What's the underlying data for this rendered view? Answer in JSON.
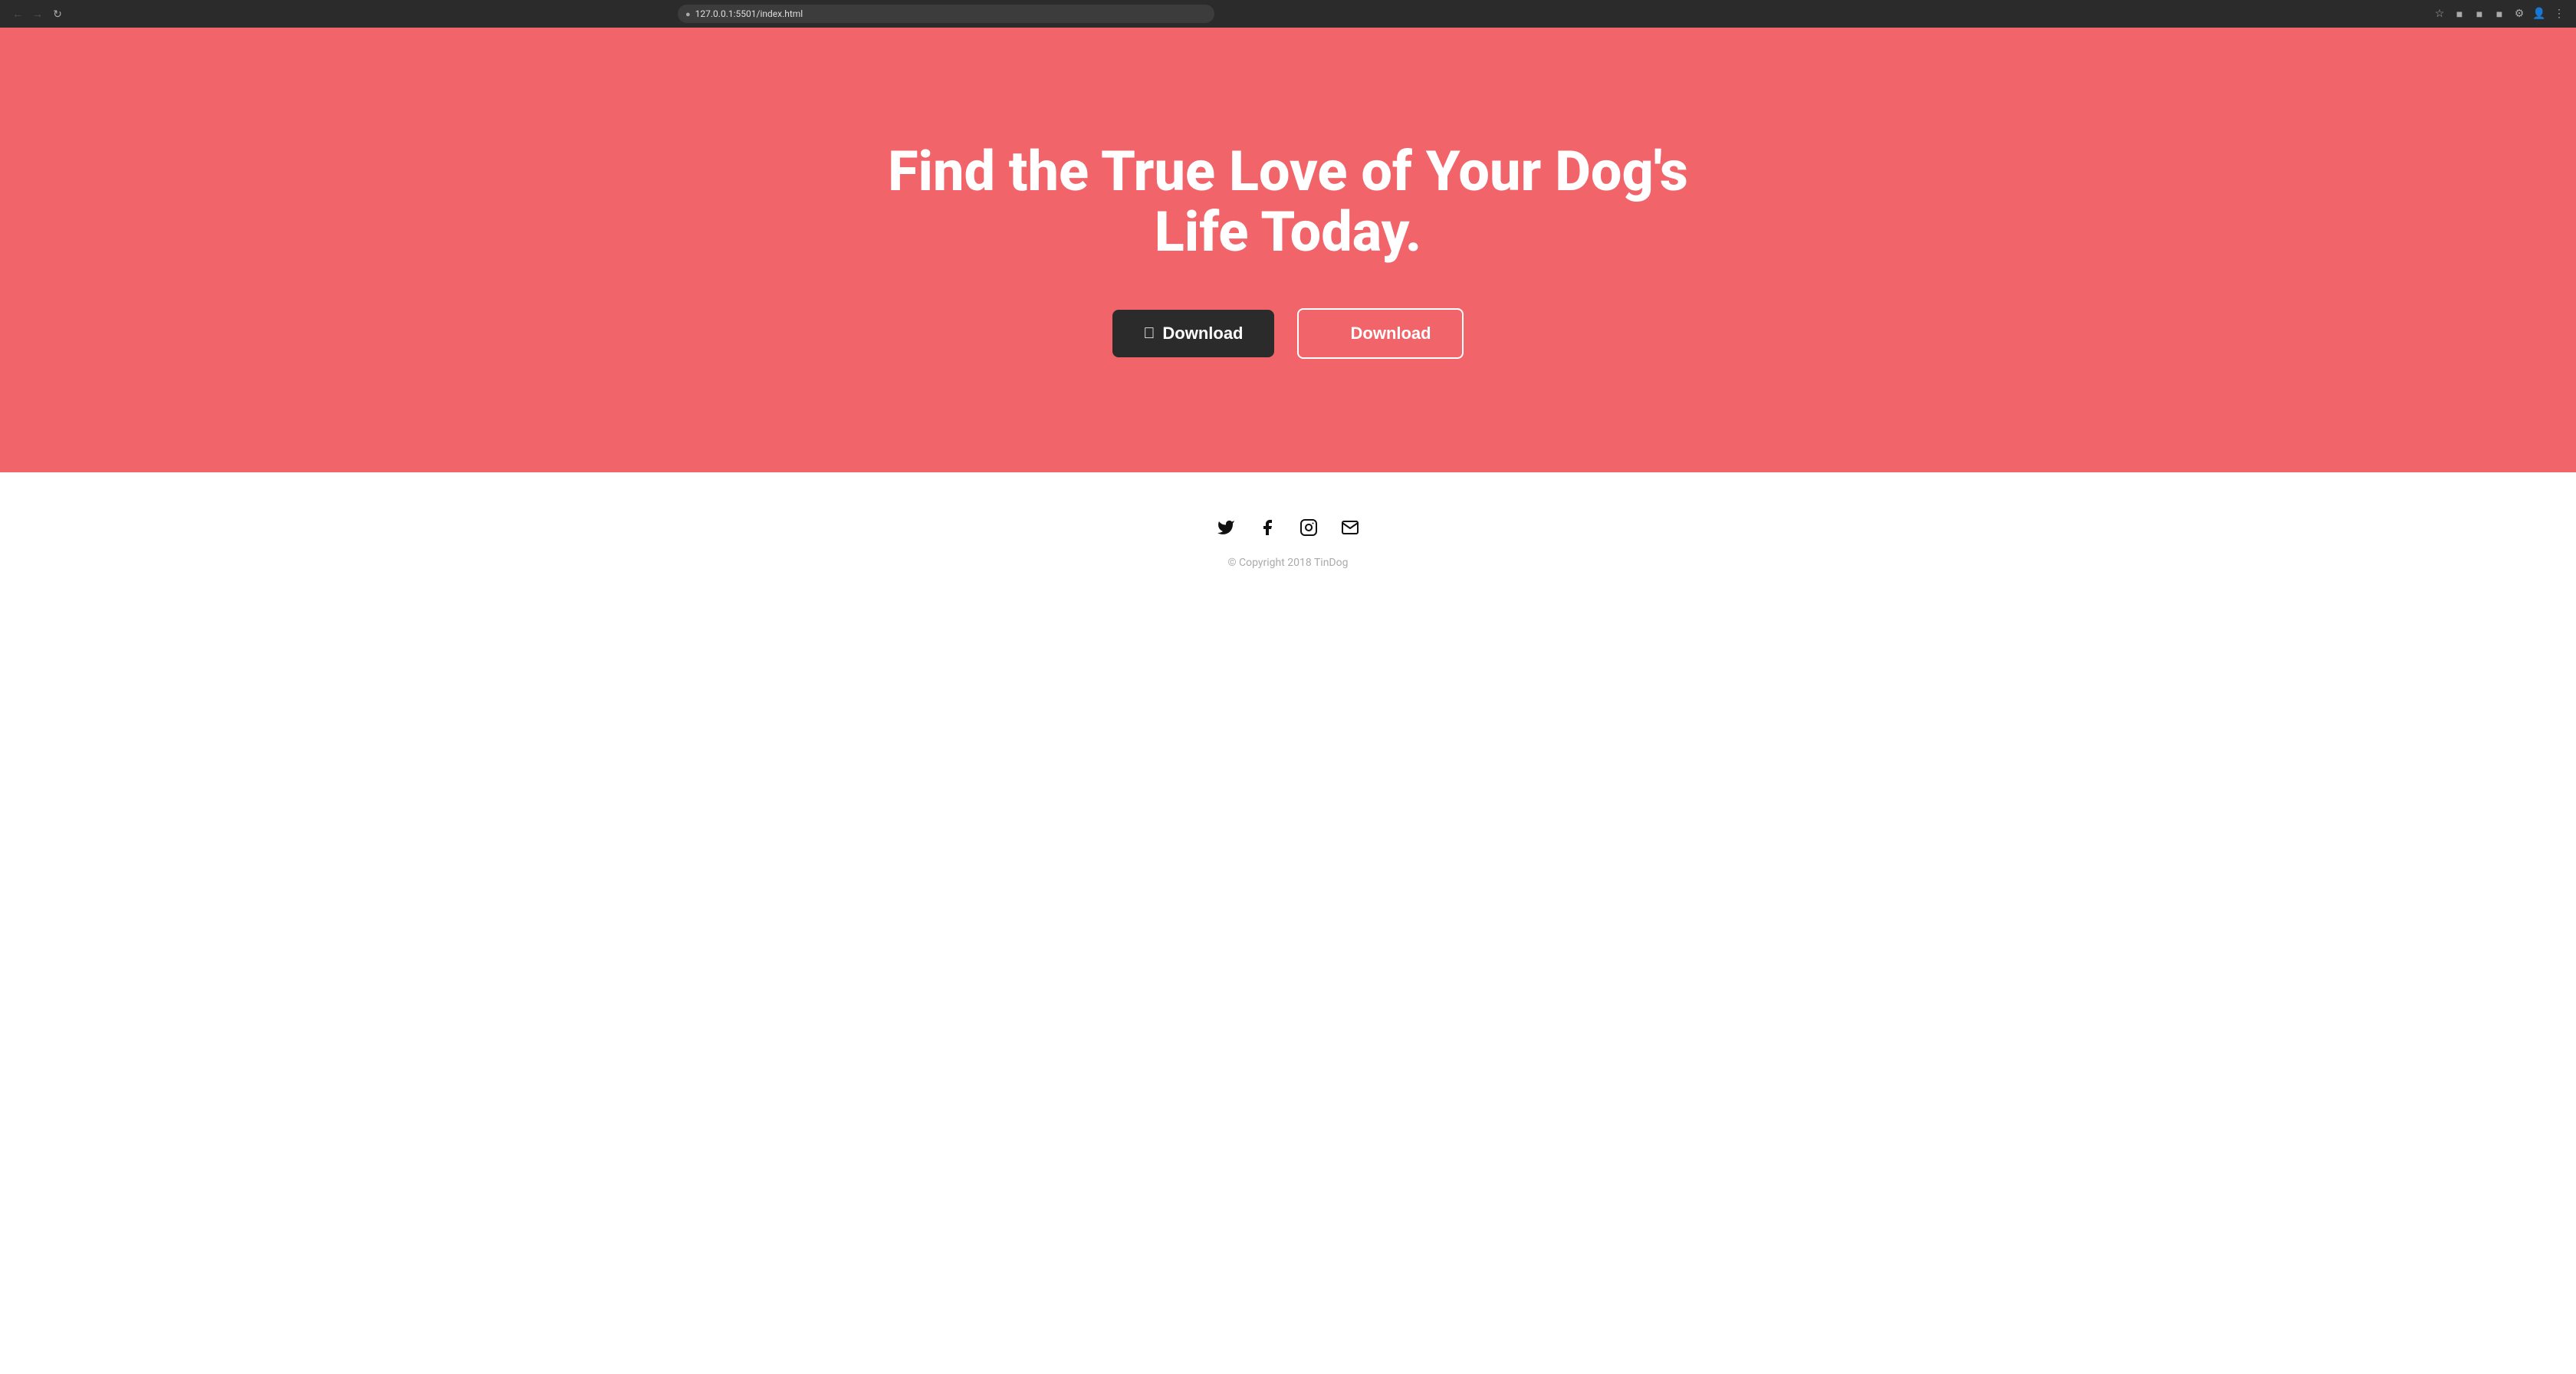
{
  "browser": {
    "url": "127.0.0.1:5501/index.html",
    "back_disabled": true,
    "forward_disabled": true
  },
  "hero": {
    "background_color": "#f0646a",
    "title": "Find the True Love of Your Dog's Life Today.",
    "apple_button_label": "Download",
    "google_button_label": "Download"
  },
  "footer": {
    "copyright": "© Copyright 2018 TinDog",
    "social_icons": [
      "twitter",
      "facebook",
      "instagram",
      "email"
    ]
  }
}
